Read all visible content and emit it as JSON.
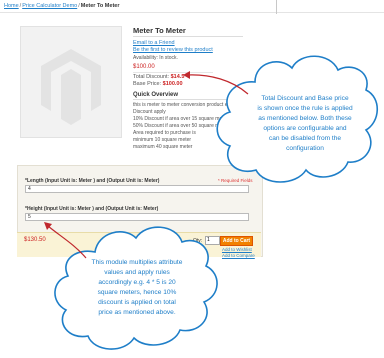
{
  "breadcrumb": {
    "home": "Home",
    "category": "Price Calculator Demo",
    "current": "Meter To Meter"
  },
  "product": {
    "title": "Meter To Meter",
    "email_friend": "Email to a Friend",
    "review_link": "Be the first to review this product",
    "availability": "Availability: In stock.",
    "price": "$100.00",
    "total_discount_label": "Total Discount:",
    "total_discount_value": "$14.5",
    "base_price_label": "Base Price:",
    "base_price_value": "$100.00",
    "quick_overview_title": "Quick Overview",
    "description_lines": [
      "this is meter to meter conversion product example",
      "Discount apply",
      "10% Discount if area over 15 square meter",
      "50% Discount if area over 50 square meter",
      "Area required to purchase is",
      "minimum 10 square meter",
      "maximum 40 square meter"
    ]
  },
  "options": {
    "required_note": "* Required Fields",
    "length_label": "*Length (Input Unit is: Meter ) and (Output Unit is: Meter)",
    "length_value": "4",
    "height_label": "*Height (Input Unit is: Meter ) and (Output Unit is: Meter)",
    "height_value": "5"
  },
  "cart": {
    "price": "$130.50",
    "qty_label": "Qty:",
    "qty_value": "1",
    "add_to_cart": "Add to Cart",
    "add_to_wishlist": "Add to Wishlist",
    "add_to_compare": "Add to Compare"
  },
  "callouts": {
    "top_lines": [
      "Total Discount and Base price",
      "is shown once the rule is applied",
      "as mentioned below. Both these",
      "options are configurable and",
      "can be disabled from the",
      "configuration"
    ],
    "bottom_lines": [
      "This module multiplies attribute",
      "values and apply rules",
      "accordingly e.g. 4 * 5 is 20",
      "square meters, hence 10%",
      "discount is applied on total",
      "price as mentioned above."
    ],
    "cloud_color": "#1e7ec8",
    "arrow_color": "#c0282d"
  }
}
